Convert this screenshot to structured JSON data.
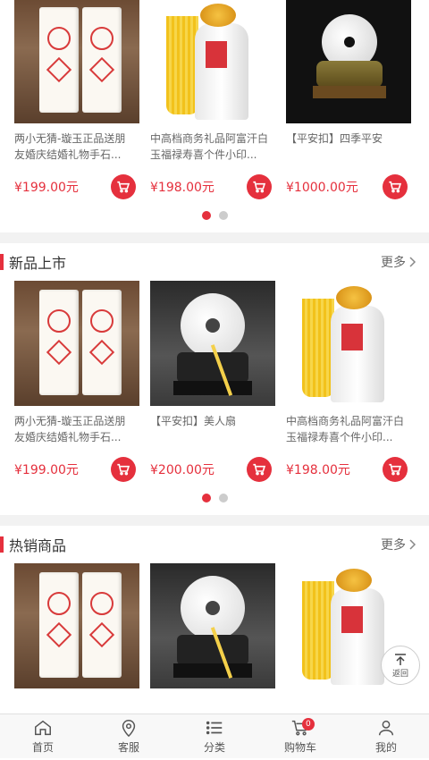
{
  "carousel_top": {
    "products": [
      {
        "name": "两小无猜-璇玉正品送朋友婚庆结婚礼物手石...",
        "price": "¥199.00元",
        "image": "seal"
      },
      {
        "name": "中高档商务礼品阿富汗白玉福禄寿喜个件小印...",
        "price": "¥198.00元",
        "image": "vase"
      },
      {
        "name": "【平安扣】四季平安",
        "price": "¥1000.00元",
        "image": "disc-black"
      }
    ],
    "dots": 2,
    "active_dot": 0
  },
  "new_arrivals": {
    "title": "新品上市",
    "more": "更多",
    "products": [
      {
        "name": "两小无猜-璇玉正品送朋友婚庆结婚礼物手石...",
        "price": "¥199.00元",
        "image": "seal"
      },
      {
        "name": "【平安扣】美人扇",
        "price": "¥200.00元",
        "image": "disc-dark"
      },
      {
        "name": "中高档商务礼品阿富汗白玉福禄寿喜个件小印...",
        "price": "¥198.00元",
        "image": "vase"
      }
    ],
    "dots": 2,
    "active_dot": 0
  },
  "hot_sales": {
    "title": "热销商品",
    "more": "更多",
    "products": [
      {
        "image": "seal"
      },
      {
        "image": "disc-dark"
      },
      {
        "image": "vase"
      }
    ]
  },
  "back_to_top": {
    "label": "返回"
  },
  "bottom_nav": {
    "items": [
      {
        "label": "首页",
        "icon": "home-icon"
      },
      {
        "label": "客服",
        "icon": "location-pin-icon"
      },
      {
        "label": "分类",
        "icon": "list-icon"
      },
      {
        "label": "购物车",
        "icon": "cart-icon",
        "badge": "0"
      },
      {
        "label": "我的",
        "icon": "user-icon"
      }
    ]
  },
  "colors": {
    "accent": "#e5303d",
    "dot_inactive": "#cccccc",
    "section_gap": "#f2f2f2"
  }
}
